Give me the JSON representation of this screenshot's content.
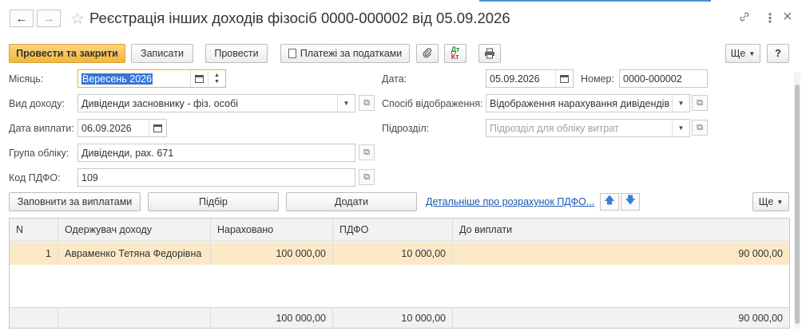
{
  "header": {
    "title": "Реєстрація інших доходів фізосіб 0000-000002 від 05.09.2026",
    "back_icon": "←",
    "forward_icon": "→",
    "star_icon": "☆",
    "link_icon": "🔗",
    "menu_icon": "⋮",
    "close_icon": "×"
  },
  "toolbar": {
    "post_close": "Провести та закрити",
    "save": "Записати",
    "post": "Провести",
    "tax_payments": "Платежі за податками",
    "more": "Ще",
    "help": "?"
  },
  "form": {
    "month_label": "Місяць:",
    "month_value": "Вересень 2026",
    "income_type_label": "Вид доходу:",
    "income_type_value": "Дивіденди засновнику - фіз. особі",
    "payment_date_label": "Дата виплати:",
    "payment_date_value": "06.09.2026",
    "accounting_group_label": "Група обліку:",
    "accounting_group_value": "Дивіденди, рах. 671",
    "pdfo_code_label": "Код ПДФО:",
    "pdfo_code_value": "109",
    "date_label": "Дата:",
    "date_value": "05.09.2026",
    "number_label": "Номер:",
    "number_value": "0000-000002",
    "reflection_label": "Спосіб відображення:",
    "reflection_value": "Відображення нарахування дивідендів ф",
    "department_label": "Підрозділ:",
    "department_placeholder": "Підрозділ для обліку витрат"
  },
  "table_toolbar": {
    "fill_by_payments": "Заповнити за виплатами",
    "pick": "Підбір",
    "add": "Додати",
    "pdfo_details_link": "Детальніше про розрахунок ПДФО...",
    "more": "Ще"
  },
  "table": {
    "columns": [
      "N",
      "Одержувач доходу",
      "Нараховано",
      "ПДФО",
      "До виплати"
    ],
    "rows": [
      {
        "n": "1",
        "recipient": "Авраменко Тетяна Федорівна",
        "accrued": "100 000,00",
        "pdfo": "10 000,00",
        "to_pay": "90 000,00"
      }
    ],
    "totals": {
      "accrued": "100 000,00",
      "pdfo": "10 000,00",
      "to_pay": "90 000,00"
    }
  }
}
